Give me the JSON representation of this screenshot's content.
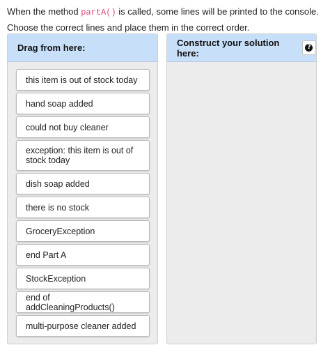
{
  "instructions": {
    "prefix": "When the method ",
    "method": "partA()",
    "suffix": " is called, some lines will be printed to the console. Choose the correct lines and place them in the correct order."
  },
  "source_panel": {
    "header": "Drag from here:"
  },
  "answer_panel": {
    "header": "Construct your solution here:",
    "help_icon": "question-circle-icon"
  },
  "blocks": [
    "this item is out of stock today",
    "hand soap added",
    "could not buy cleaner",
    "exception: this item is out of stock today",
    "dish soap added",
    "there is no stock",
    "GroceryException",
    "end Part A",
    "StockException",
    "end of addCleaningProducts()",
    "multi-purpose cleaner added"
  ]
}
